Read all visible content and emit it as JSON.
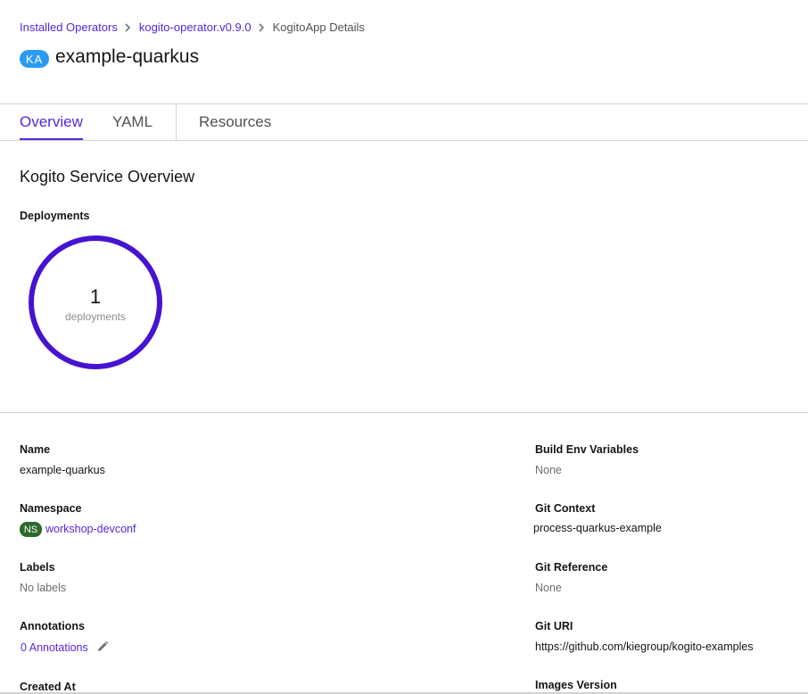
{
  "breadcrumb": {
    "installed": "Installed Operators",
    "operator": "kogito-operator.v0.9.0",
    "current": "KogitoApp Details"
  },
  "header": {
    "badge": "KA",
    "title": "example-quarkus"
  },
  "tabs": [
    {
      "label": "Overview"
    },
    {
      "label": "YAML"
    },
    {
      "label": "Resources"
    }
  ],
  "overview": {
    "title": "Kogito Service Overview",
    "deployments_label": "Deployments",
    "deployments_count": "1",
    "deployments_unit": "deployments"
  },
  "details": {
    "name_label": "Name",
    "name_value": "example-quarkus",
    "namespace_label": "Namespace",
    "namespace_badge": "NS",
    "namespace_value": "workshop-devconf",
    "labels_label": "Labels",
    "labels_value": "No labels",
    "annotations_label": "Annotations",
    "annotations_value": "0 Annotations",
    "created_label": "Created At",
    "build_env_label": "Build Env Variables",
    "build_env_value": "None",
    "git_context_label": "Git Context",
    "git_context_value": "process-quarkus-example",
    "git_ref_label": "Git Reference",
    "git_ref_value": "None",
    "git_uri_label": "Git URI",
    "git_uri_value": "https://github.com/kiegroup/kogito-examples",
    "images_version_label": "Images Version"
  },
  "colors": {
    "accent": "#5627d8",
    "donut": "#4614d0",
    "ka_badge": "#2b9af3",
    "ns_badge": "#2b6a2b"
  }
}
